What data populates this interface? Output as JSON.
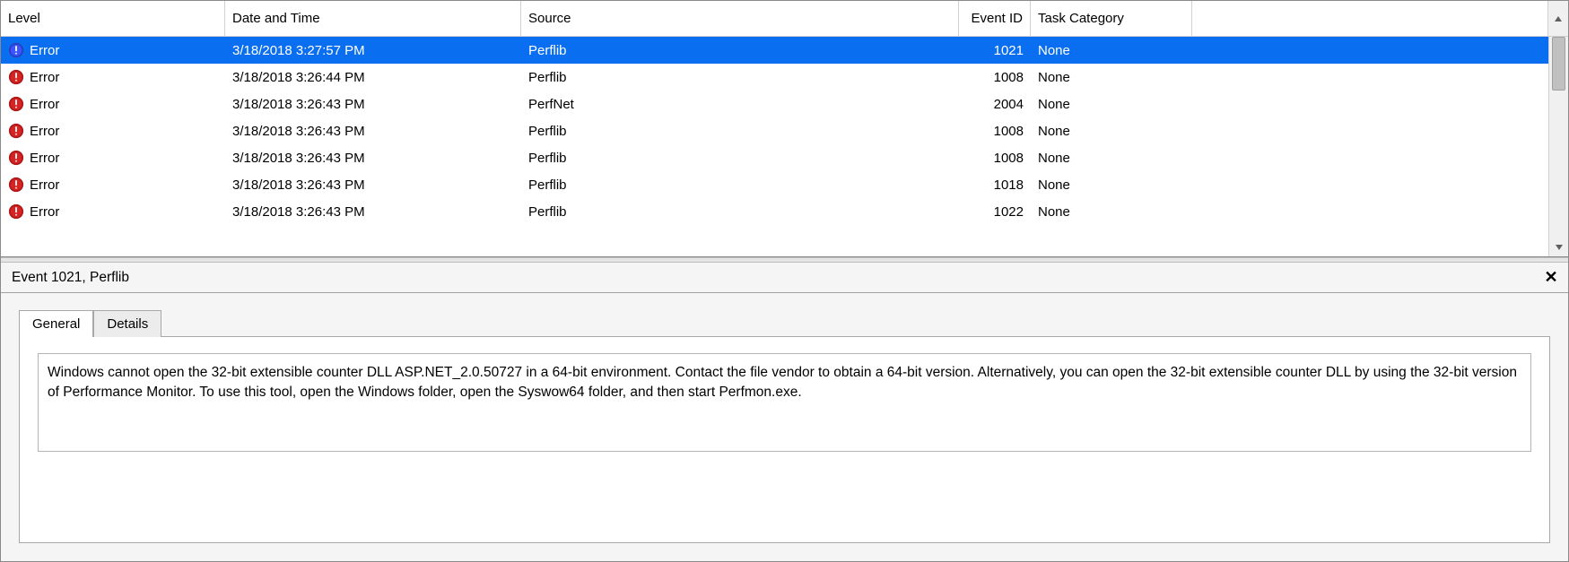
{
  "columns": {
    "level": "Level",
    "datetime": "Date and Time",
    "source": "Source",
    "event_id": "Event ID",
    "task_category": "Task Category"
  },
  "events": [
    {
      "level": "Error",
      "datetime": "3/18/2018 3:27:57 PM",
      "source": "Perflib",
      "event_id": "1021",
      "task_category": "None",
      "selected": true
    },
    {
      "level": "Error",
      "datetime": "3/18/2018 3:26:44 PM",
      "source": "Perflib",
      "event_id": "1008",
      "task_category": "None",
      "selected": false
    },
    {
      "level": "Error",
      "datetime": "3/18/2018 3:26:43 PM",
      "source": "PerfNet",
      "event_id": "2004",
      "task_category": "None",
      "selected": false
    },
    {
      "level": "Error",
      "datetime": "3/18/2018 3:26:43 PM",
      "source": "Perflib",
      "event_id": "1008",
      "task_category": "None",
      "selected": false
    },
    {
      "level": "Error",
      "datetime": "3/18/2018 3:26:43 PM",
      "source": "Perflib",
      "event_id": "1008",
      "task_category": "None",
      "selected": false
    },
    {
      "level": "Error",
      "datetime": "3/18/2018 3:26:43 PM",
      "source": "Perflib",
      "event_id": "1018",
      "task_category": "None",
      "selected": false
    },
    {
      "level": "Error",
      "datetime": "3/18/2018 3:26:43 PM",
      "source": "Perflib",
      "event_id": "1022",
      "task_category": "None",
      "selected": false
    }
  ],
  "detail": {
    "title": "Event 1021, Perflib",
    "tabs": {
      "general": "General",
      "details": "Details"
    },
    "message": "Windows cannot open the 32-bit extensible counter DLL ASP.NET_2.0.50727 in a 64-bit environment. Contact the file vendor to obtain a 64-bit version. Alternatively, you can open the 32-bit extensible counter DLL by using the 32-bit version of Performance Monitor. To use this tool, open the Windows folder, open the Syswow64 folder, and then start Perfmon.exe."
  }
}
